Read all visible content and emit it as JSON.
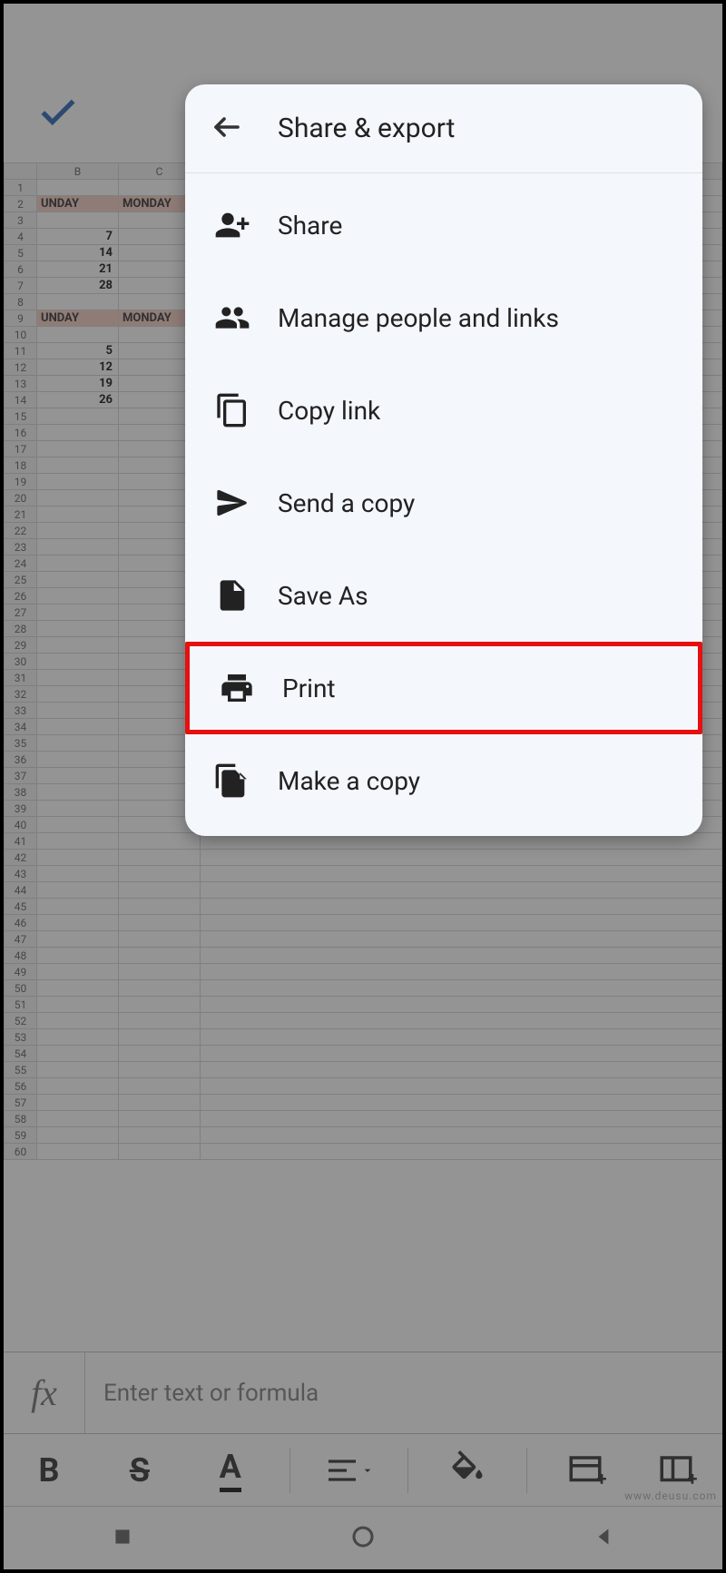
{
  "menu": {
    "title": "Share & export",
    "items": [
      {
        "id": "share",
        "label": "Share",
        "icon": "person-add-icon"
      },
      {
        "id": "manage",
        "label": "Manage people and links",
        "icon": "people-icon"
      },
      {
        "id": "copylink",
        "label": "Copy link",
        "icon": "copy-icon"
      },
      {
        "id": "sendcopy",
        "label": "Send a copy",
        "icon": "send-icon"
      },
      {
        "id": "saveas",
        "label": "Save As",
        "icon": "file-icon"
      },
      {
        "id": "print",
        "label": "Print",
        "icon": "print-icon",
        "highlighted": true
      },
      {
        "id": "makecopy",
        "label": "Make a copy",
        "icon": "file-copy-icon"
      }
    ]
  },
  "formula_bar": {
    "fx": "fx",
    "placeholder": "Enter text or formula"
  },
  "toolbar": {
    "bold": "B",
    "strike": "S",
    "underline": "A"
  },
  "spreadsheet": {
    "columns": [
      "",
      "B",
      "C"
    ],
    "rows": [
      {
        "n": 1,
        "b": "",
        "c": ""
      },
      {
        "n": 2,
        "b": "UNDAY",
        "c": "MONDAY",
        "hl": true
      },
      {
        "n": 3,
        "b": "",
        "c": ""
      },
      {
        "n": 4,
        "b": "7",
        "c": "",
        "num": true
      },
      {
        "n": 5,
        "b": "14",
        "c": "",
        "num": true
      },
      {
        "n": 6,
        "b": "21",
        "c": "",
        "num": true
      },
      {
        "n": 7,
        "b": "28",
        "c": "",
        "num": true
      },
      {
        "n": 8,
        "b": "",
        "c": ""
      },
      {
        "n": 9,
        "b": "UNDAY",
        "c": "MONDAY",
        "hl": true
      },
      {
        "n": 10,
        "b": "",
        "c": ""
      },
      {
        "n": 11,
        "b": "5",
        "c": "",
        "num": true
      },
      {
        "n": 12,
        "b": "12",
        "c": "",
        "num": true
      },
      {
        "n": 13,
        "b": "19",
        "c": "",
        "num": true
      },
      {
        "n": 14,
        "b": "26",
        "c": "",
        "num": true
      }
    ]
  },
  "watermark": "www.deusu.com"
}
